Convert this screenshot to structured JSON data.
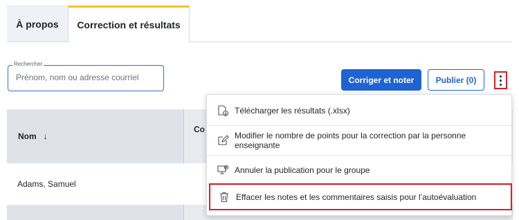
{
  "tabs": [
    {
      "label": "À propos",
      "active": false
    },
    {
      "label": "Correction et résultats",
      "active": true
    }
  ],
  "search": {
    "legend": "Rechercher",
    "placeholder": "Prénom, nom ou adresse courriel",
    "value": ""
  },
  "toolbar": {
    "grade_button": "Corriger et noter",
    "publish_button": "Publier (0)",
    "more_button_icon": "kebab-vertical-icon"
  },
  "table": {
    "columns": [
      {
        "label": "Nom",
        "sort_icon": "↓"
      },
      {
        "label": "Co"
      }
    ],
    "rows": [
      {
        "name": "Adams, Samuel"
      },
      {
        "name": ""
      }
    ]
  },
  "menu": {
    "items": [
      {
        "label": "Télécharger les résultats (.xlsx)",
        "icon": "download-file-icon"
      },
      {
        "label": "Modifier le nombre de points pour la correction par la personne enseignante",
        "icon": "edit-icon"
      },
      {
        "label": "Annuler la publication pour le groupe",
        "icon": "unpublish-icon"
      },
      {
        "label": "Effacer les notes et les commentaires saisis pour l’autoévaluation",
        "icon": "trash-icon",
        "highlighted": true
      }
    ]
  },
  "colors": {
    "primary": "#1f63d3",
    "highlight_border": "#d71e28",
    "active_tab_accent": "#f2c12e",
    "header_bg": "#dfe3e9"
  }
}
